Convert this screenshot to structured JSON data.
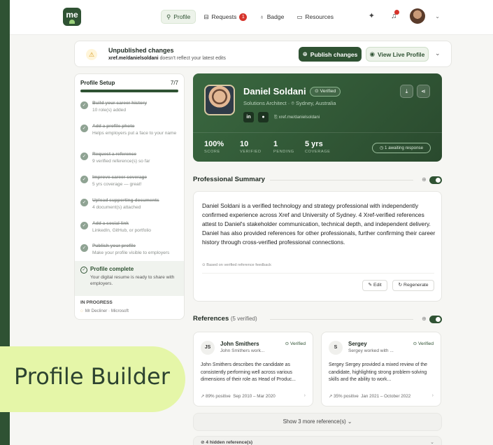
{
  "nav": {
    "logo": "me",
    "tabs": [
      {
        "label": "Profile",
        "icon": "person-icon"
      },
      {
        "label": "Requests",
        "icon": "inbox-icon",
        "badge": "1"
      },
      {
        "label": "Badge",
        "icon": "badge-icon"
      },
      {
        "label": "Resources",
        "icon": "folder-icon"
      }
    ]
  },
  "banner": {
    "title": "Unpublished changes",
    "url": "xref.me/danielsoldani",
    "subtitle_rest": " doesn't reflect your latest edits",
    "publish_label": "Publish changes",
    "live_label": "View Live Profile"
  },
  "setup": {
    "title": "Profile Setup",
    "count": "7/7",
    "progress": 1.0,
    "steps": [
      {
        "title": "Build your career history",
        "desc": "10 role(s) added"
      },
      {
        "title": "Add a profile photo",
        "desc": "Helps employers put a face to your name"
      },
      {
        "title": "Request a reference",
        "desc": "9 verified reference(s) so far"
      },
      {
        "title": "Improve career coverage",
        "desc": "5 yrs coverage — great!"
      },
      {
        "title": "Upload supporting documents",
        "desc": "4 document(s) attached"
      },
      {
        "title": "Add a social link",
        "desc": "LinkedIn, GitHub, or portfolio"
      },
      {
        "title": "Publish your profile",
        "desc": "Make your profile visible to employers"
      }
    ],
    "complete_title": "Profile complete",
    "complete_desc": "Your digital resume is ready to share with employers.",
    "inprogress_title": "IN PROGRESS",
    "inprogress_item": "Mr Decliner · Microsoft"
  },
  "profile": {
    "name": "Daniel Soldani",
    "verified": "Verified",
    "role": "Solutions Architect",
    "location": "Sydney, Australia",
    "social_linkedin": "in",
    "url": "xref.me/danielsoldani",
    "stats": [
      {
        "value": "100%",
        "label": "SCORE"
      },
      {
        "value": "10",
        "label": "VERIFIED"
      },
      {
        "value": "1",
        "label": "PENDING"
      },
      {
        "value": "5 yrs",
        "label": "COVERAGE"
      }
    ],
    "awaiting": "1 awaiting response"
  },
  "summary": {
    "title": "Professional Summary",
    "text": "Daniel Soldani is a verified technology and strategy professional with independently confirmed experience across Xref and University of Sydney. 4 Xref-verified references attest to Daniel's stakeholder communication, technical depth, and independent delivery. Daniel has also provided references for other professionals, further confirming their career history through cross-verified professional connections.",
    "note": "Based on verified reference feedback",
    "edit_label": "Edit",
    "regen_label": "Regenerate"
  },
  "references": {
    "title": "References",
    "count": "(5 verified)",
    "items": [
      {
        "initials": "JS",
        "name": "John Smithers",
        "sub": "John Smithers work...",
        "verified": "Verified",
        "text": "John Smithers describes the candidate as consistently performing well across various dimensions of their role as Head of Produc...",
        "positive": "89% positive",
        "dates": "Sep 2010 – Mar 2020"
      },
      {
        "initials": "S",
        "name": "Sergey",
        "sub": "Sergey worked with ...",
        "verified": "Verified",
        "text": "Sergey Sergey provided a mixed review of the candidate, highlighting strong problem-solving skills and the ability to work...",
        "positive": "35% positive",
        "dates": "Jan 2021 – October 2022"
      }
    ],
    "show_more": "Show 3 more reference(s)",
    "hidden": "4 hidden reference(s)"
  },
  "overlay": {
    "label": "Profile Builder"
  }
}
